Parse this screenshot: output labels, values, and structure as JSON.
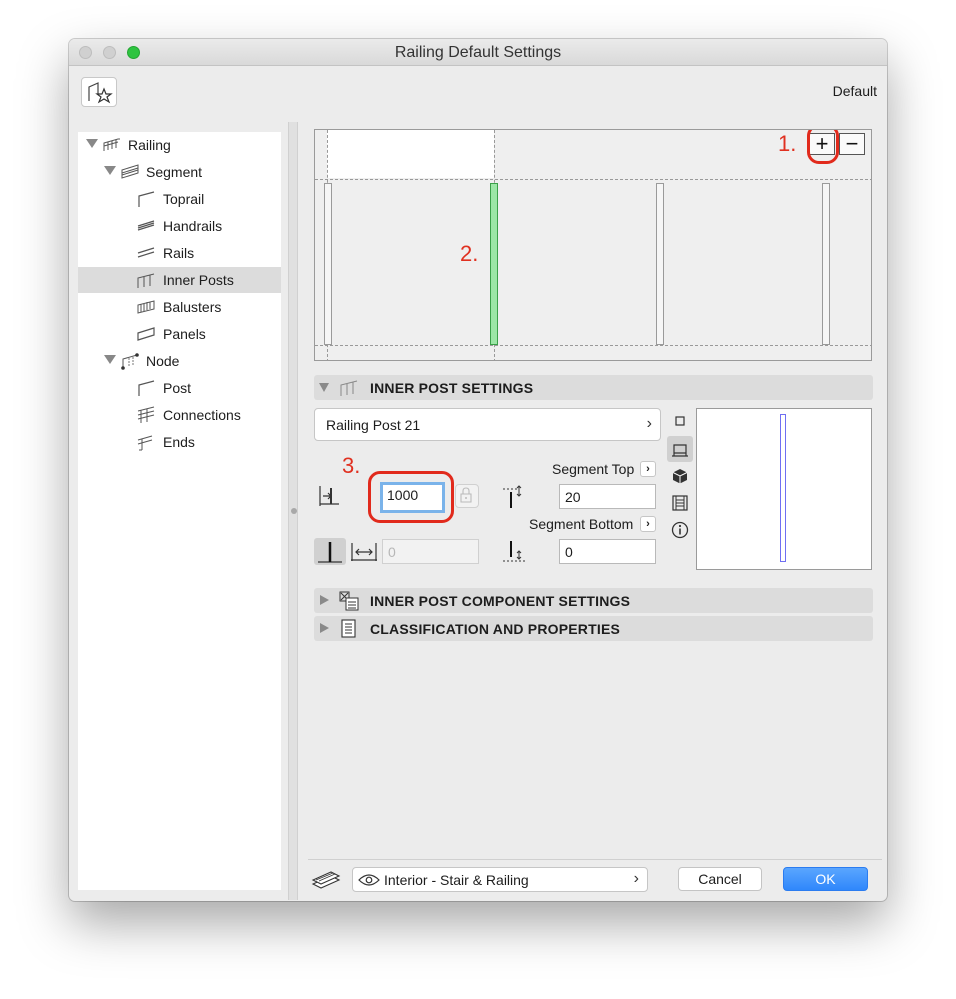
{
  "window": {
    "title": "Railing Default Settings"
  },
  "header": {
    "default_label": "Default"
  },
  "tree": {
    "items": [
      {
        "label": "Railing",
        "icon": "railing-icon"
      },
      {
        "label": "Segment",
        "icon": "segment-icon"
      },
      {
        "label": "Toprail",
        "icon": "toprail-icon"
      },
      {
        "label": "Handrails",
        "icon": "handrails-icon"
      },
      {
        "label": "Rails",
        "icon": "rails-icon"
      },
      {
        "label": "Inner Posts",
        "icon": "inner-posts-icon",
        "selected": true
      },
      {
        "label": "Balusters",
        "icon": "balusters-icon"
      },
      {
        "label": "Panels",
        "icon": "panels-icon"
      },
      {
        "label": "Node",
        "icon": "node-icon"
      },
      {
        "label": "Post",
        "icon": "post-icon"
      },
      {
        "label": "Connections",
        "icon": "connections-icon"
      },
      {
        "label": "Ends",
        "icon": "ends-icon"
      }
    ]
  },
  "preview": {
    "plus_label": "+",
    "minus_label": "−",
    "annotations": {
      "step1": "1.",
      "step2": "2.",
      "step3": "3."
    }
  },
  "inner_post_settings": {
    "title": "INNER POST SETTINGS",
    "post_type": "Railing Post 21",
    "offset_value": "1000",
    "spacing_value": "0",
    "segment_top_label": "Segment Top",
    "segment_top_value": "20",
    "segment_bottom_label": "Segment Bottom",
    "segment_bottom_value": "0"
  },
  "sections": {
    "component": "INNER POST COMPONENT SETTINGS",
    "classification": "CLASSIFICATION AND PROPERTIES"
  },
  "footer": {
    "layer": "Interior - Stair & Railing",
    "cancel_label": "Cancel",
    "ok_label": "OK"
  },
  "colors": {
    "accent": "#3a8efc",
    "highlight_ring": "#e12a1c",
    "selected_post": "#9ce6a6"
  }
}
